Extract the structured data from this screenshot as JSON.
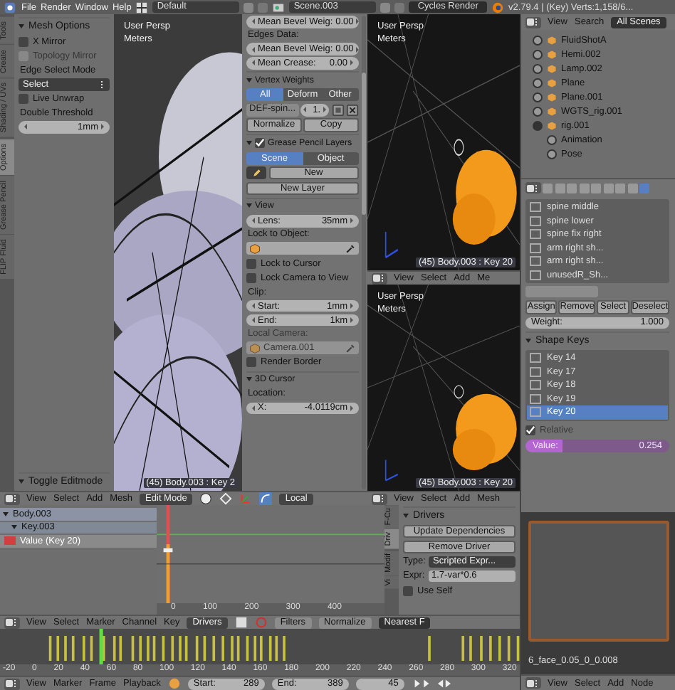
{
  "top_bar": {
    "menus": [
      "File",
      "Render",
      "Window",
      "Help"
    ],
    "screen_layout": "Default",
    "scene": "Scene.003",
    "render_engine": "Cycles Render",
    "stats": "v2.79.4 | (Key) Verts:1,158/6..."
  },
  "tool_shelf": {
    "tabs": [
      {
        "label": "Tools",
        "selected": false
      },
      {
        "label": "Create",
        "selected": false
      },
      {
        "label": "Shading / UVs",
        "selected": false
      },
      {
        "label": "Options",
        "selected": true
      },
      {
        "label": "Grease Pencil",
        "selected": false
      },
      {
        "label": "FLIP Fluid",
        "selected": false
      }
    ],
    "rows": [
      {
        "kind": "section",
        "text": "Mesh Options",
        "expanded": true
      },
      {
        "kind": "checkbox",
        "label": "X Mirror",
        "checked": false,
        "disabled": false
      },
      {
        "kind": "checkbox",
        "label": "Topology Mirror",
        "checked": false,
        "disabled": true
      },
      {
        "kind": "label",
        "text": "Edge Select Mode"
      },
      {
        "kind": "dropdown",
        "value": "Select"
      },
      {
        "kind": "checkbox",
        "label": "Live Unwrap",
        "checked": false,
        "disabled": false
      },
      {
        "kind": "label",
        "text": "Double Threshold"
      },
      {
        "kind": "field",
        "value": "1mm"
      }
    ],
    "operator_panel": "Toggle Editmode"
  },
  "viewport_left": {
    "view_name": "User Persp",
    "units": "Meters",
    "status": "(45) Body.003 : Key 2"
  },
  "n_panel": {
    "rows": [
      {
        "kind": "field",
        "label": "Mean Bevel Weig:",
        "value": "0.00"
      },
      {
        "kind": "label",
        "text": "Edges Data:"
      },
      {
        "kind": "field",
        "label": "Mean Bevel Weig:",
        "value": "0.00"
      },
      {
        "kind": "field",
        "label": "Mean Crease:",
        "value": "0.00"
      },
      {
        "kind": "section",
        "text": "Vertex Weights",
        "expanded": true
      },
      {
        "kind": "segmented",
        "options": [
          {
            "label": "All",
            "selected": true
          },
          {
            "label": "Deform",
            "selected": false
          },
          {
            "label": "Other",
            "selected": false
          }
        ]
      },
      {
        "kind": "weight_row",
        "name": "DEF-spin...",
        "value": "1."
      },
      {
        "kind": "buttons",
        "buttons": [
          "Normalize",
          "Copy"
        ]
      },
      {
        "kind": "section",
        "text": "Grease Pencil Layers",
        "expanded": true,
        "checked": true
      },
      {
        "kind": "segmented",
        "options": [
          {
            "label": "Scene",
            "selected": true
          },
          {
            "label": "Object",
            "selected": false
          }
        ]
      },
      {
        "kind": "new_row",
        "label": "New"
      },
      {
        "kind": "buttons",
        "buttons": [
          "New Layer"
        ]
      },
      {
        "kind": "section",
        "text": "View",
        "expanded": true
      },
      {
        "kind": "field",
        "label": "Lens:",
        "value": "35mm"
      },
      {
        "kind": "label",
        "text": "Lock to Object:"
      },
      {
        "kind": "object_field",
        "disabled": false
      },
      {
        "kind": "checkbox",
        "label": "Lock to Cursor",
        "checked": false,
        "disabled": false
      },
      {
        "kind": "checkbox",
        "label": "Lock Camera to View",
        "checked": false,
        "disabled": false
      },
      {
        "kind": "label",
        "text": "Clip:"
      },
      {
        "kind": "field",
        "label": "Start:",
        "value": "1mm"
      },
      {
        "kind": "field",
        "label": "End:",
        "value": "1km"
      },
      {
        "kind": "label",
        "text": "Local Camera:",
        "disabled": true
      },
      {
        "kind": "object_field",
        "value": "Camera.001",
        "disabled": true
      },
      {
        "kind": "checkbox",
        "label": "Render Border",
        "checked": false,
        "disabled": false
      },
      {
        "kind": "section",
        "text": "3D Cursor",
        "expanded": true
      },
      {
        "kind": "label",
        "text": "Location:"
      },
      {
        "kind": "field",
        "label": "X:",
        "value": "-4.0119cm"
      }
    ]
  },
  "viewport_top": {
    "view_name": "User Persp",
    "units": "Meters",
    "status": "(45) Body.003 : Key 20"
  },
  "viewport_top_header": {
    "menus": [
      "View",
      "Select",
      "Add",
      "Me"
    ]
  },
  "viewport_bottom": {
    "view_name": "User Persp",
    "units": "Meters",
    "status": "(45) Body.003 : Key 20"
  },
  "viewport_bottom_header": {
    "menus": [
      "View",
      "Select",
      "Add",
      "Mesh"
    ]
  },
  "main_header": {
    "menus": [
      "View",
      "Select",
      "Add",
      "Mesh"
    ],
    "mode": "Edit Mode",
    "orientation": "Local"
  },
  "outliner": {
    "menus": [
      "View",
      "Search"
    ],
    "display_mode": "All Scenes",
    "items": [
      {
        "name": "FluidShotA",
        "expanded": false
      },
      {
        "name": "Hemi.002",
        "expanded": false
      },
      {
        "name": "Lamp.002",
        "expanded": false
      },
      {
        "name": "Plane",
        "expanded": false
      },
      {
        "name": "Plane.001",
        "expanded": false
      },
      {
        "name": "WGTS_rig.001",
        "expanded": false
      },
      {
        "name": "rig.001",
        "expanded": true,
        "children": [
          {
            "name": "Animation",
            "expanded": false
          },
          {
            "name": "Pose",
            "expanded": false
          }
        ]
      }
    ]
  },
  "properties": {
    "tabs": [
      {
        "selected": false
      },
      {
        "selected": false
      },
      {
        "selected": false
      },
      {
        "selected": false
      },
      {
        "selected": false
      },
      {
        "selected": false
      },
      {
        "selected": false
      },
      {
        "selected": false
      },
      {
        "selected": true
      }
    ],
    "vertex_groups": [
      "spine middle",
      "spine lower",
      "spine fix right",
      "arm right sh...",
      "arm right sh...",
      "unusedR_Sh..."
    ],
    "group_buttons": [
      "Assign",
      "Remove",
      "Select",
      "Deselect"
    ],
    "weight": {
      "label": "Weight:",
      "value": "1.000"
    },
    "shape_keys": {
      "title": "Shape Keys",
      "expanded": true,
      "items": [
        {
          "name": "Key 14",
          "selected": false
        },
        {
          "name": "Key 17",
          "selected": false
        },
        {
          "name": "Key 18",
          "selected": false
        },
        {
          "name": "Key 19",
          "selected": false
        },
        {
          "name": "Key 20",
          "selected": true
        }
      ],
      "relative": {
        "label": "Relative",
        "checked": true
      },
      "value": {
        "label": "Value:",
        "reading": "0.254",
        "level": 0.254
      }
    }
  },
  "node_editor": {
    "frame_label": "6_face_0.05_0_0.008",
    "menus": [
      "View",
      "Select",
      "Add",
      "Node"
    ]
  },
  "graph_editor": {
    "channels": [
      {
        "name": "Body.003",
        "expanded": true,
        "children": [
          {
            "name": "Key.003",
            "expanded": true,
            "children": [
              {
                "name": "Value (Key 20)",
                "selected": true
              }
            ]
          }
        ]
      }
    ],
    "ruler": [
      "0",
      "100",
      "200",
      "300",
      "400"
    ],
    "side_tabs": [
      {
        "label": "F-Cu",
        "selected": false
      },
      {
        "label": "Driv",
        "selected": true
      },
      {
        "label": "Modif",
        "selected": false
      },
      {
        "label": "Vi",
        "selected": false
      }
    ],
    "drivers": {
      "title": "Drivers",
      "buttons": [
        "Update Dependencies",
        "Remove Driver"
      ],
      "type_label": "Type:",
      "type": "Scripted Expr...",
      "expr_label": "Expr:",
      "expr": "1.7-var*0.6",
      "use_self": {
        "label": "Use Self",
        "checked": false
      }
    }
  },
  "graph_header": {
    "menus": [
      "View",
      "Select",
      "Marker",
      "Channel",
      "Key"
    ],
    "mode": "Drivers",
    "filters": "Filters",
    "normalize": "Normalize",
    "interpolation": "Nearest F"
  },
  "timeline": {
    "ruler": [
      "-20",
      "0",
      "20",
      "40",
      "60",
      "80",
      "100",
      "120",
      "140",
      "160",
      "180",
      "200",
      "220",
      "240",
      "260",
      "280",
      "300",
      "320"
    ]
  },
  "timeline_header": {
    "menus": [
      "View",
      "Marker",
      "Frame",
      "Playback"
    ],
    "start": {
      "label": "Start:",
      "value": "289"
    },
    "end": {
      "label": "End:",
      "value": "389"
    },
    "current_frame": "45"
  }
}
